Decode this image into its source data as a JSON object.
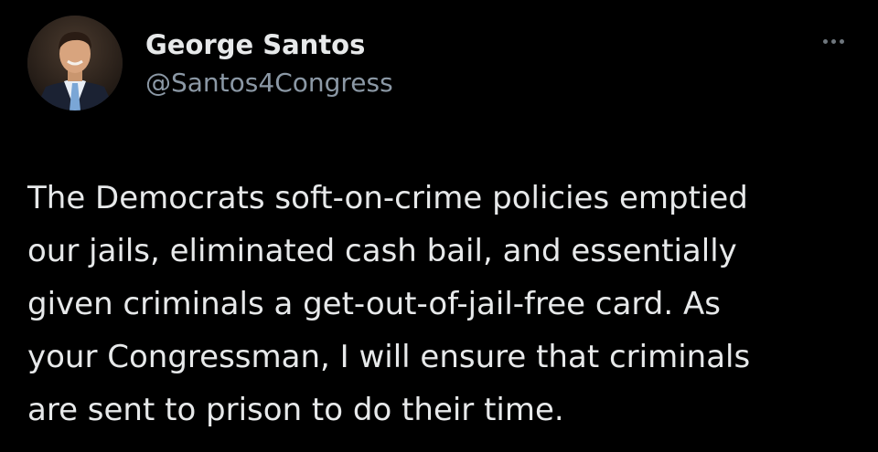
{
  "author": {
    "display_name": "George Santos",
    "handle": "@Santos4Congress",
    "avatar_icon": "profile-photo"
  },
  "menu": {
    "icon": "more-options-icon"
  },
  "tweet": {
    "lines": [
      "The Democrats soft-on-crime policies emptied",
      "our jails, eliminated cash bail, and essentially",
      "given criminals a get-out-of-jail-free card. As",
      "your Congressman, I will ensure that criminals",
      "are sent to prison to do their time."
    ]
  },
  "colors": {
    "background": "#000000",
    "primary_text": "#e7e9ea",
    "secondary_text": "#8b98a5"
  }
}
